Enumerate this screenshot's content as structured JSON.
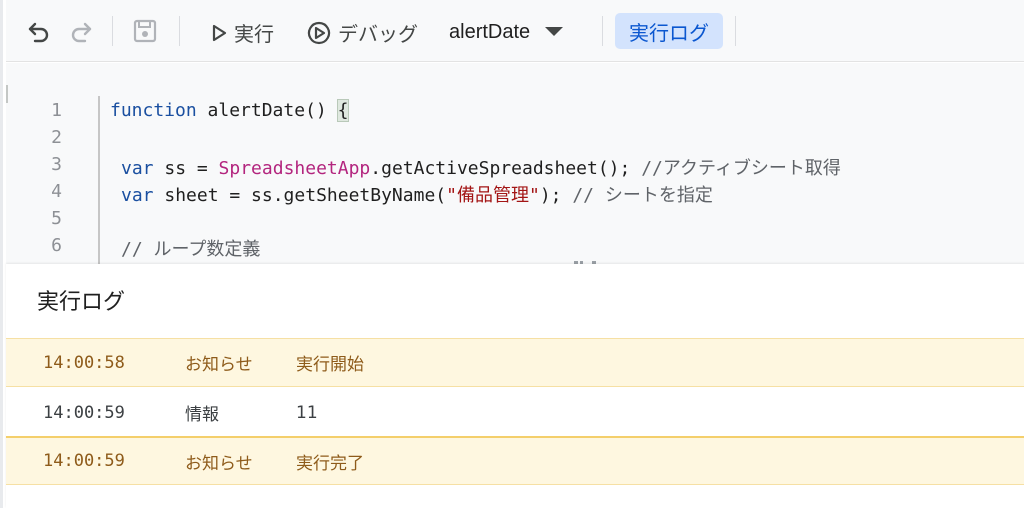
{
  "toolbar": {
    "run_label": "実行",
    "debug_label": "デバッグ",
    "function_name": "alertDate",
    "exec_log_label": "実行ログ"
  },
  "editor": {
    "line_numbers": [
      "1",
      "2",
      "3",
      "4",
      "5",
      "6"
    ],
    "line1": {
      "kw": "function",
      "rest": " alertDate() ",
      "brace": "{"
    },
    "line3": {
      "kw": "var",
      "mid": " ss = ",
      "cls": "SpreadsheetApp",
      "rest": ".getActiveSpreadsheet(); ",
      "cmt": "//アクティブシート取得"
    },
    "line4": {
      "kw": "var",
      "mid": " sheet = ss.getSheetByName(",
      "str": "\"備品管理\"",
      "rest": "); ",
      "cmt": "// シートを指定"
    },
    "line6": {
      "cmt": "// ループ数定義"
    }
  },
  "log": {
    "title": "実行ログ",
    "rows": [
      {
        "time": "14:00:58",
        "level": "お知らせ",
        "message": "実行開始"
      },
      {
        "time": "14:00:59",
        "level": "情報",
        "message": "11"
      },
      {
        "time": "14:00:59",
        "level": "お知らせ",
        "message": "実行完了"
      }
    ]
  },
  "colors": {
    "notice_bg": "#fef7e0",
    "notice_text": "#8e5b1a",
    "accent": "#0b57d0",
    "accent_bg": "#d3e3fd"
  }
}
